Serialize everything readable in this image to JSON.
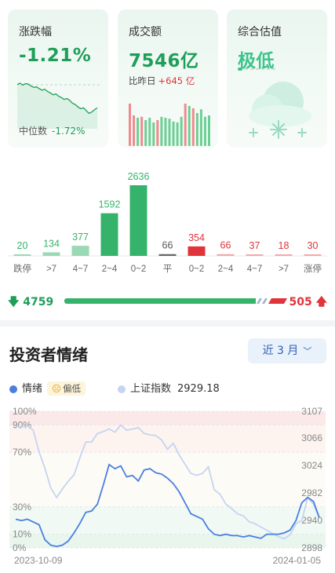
{
  "cards": {
    "change": {
      "title": "涨跌幅",
      "value": "-1.21%",
      "median_label": "中位数",
      "median_value": "-1.72%",
      "trend": [
        0.3,
        0.27,
        0.31,
        0.28,
        0.29,
        0.33,
        0.36,
        0.35,
        0.39,
        0.42,
        0.4,
        0.45,
        0.48,
        0.52,
        0.5,
        0.55,
        0.58,
        0.62,
        0.6,
        0.64,
        0.7,
        0.73,
        0.78,
        0.82,
        0.8,
        0.86,
        0.92,
        0.89,
        0.84,
        0.8
      ]
    },
    "turnover": {
      "title": "成交额",
      "value": "7546亿",
      "compare_label": "比昨日",
      "compare_value": "+645 亿",
      "bars": [
        0.9,
        0.65,
        0.6,
        0.62,
        0.55,
        0.6,
        0.5,
        0.55,
        0.62,
        0.6,
        0.58,
        0.52,
        0.5,
        0.62,
        0.9,
        0.85,
        0.8,
        0.7,
        0.78,
        0.62,
        0.65
      ],
      "bar_colors": [
        "r",
        "r",
        "g",
        "r",
        "g",
        "g",
        "g",
        "r",
        "g",
        "g",
        "g",
        "g",
        "g",
        "g",
        "r",
        "g",
        "r",
        "g",
        "g",
        "g",
        "g"
      ]
    },
    "valuation": {
      "title": "综合估值",
      "value": "极低"
    }
  },
  "histogram": {
    "categories": [
      "跌停",
      ">7",
      "4~7",
      "2~4",
      "0~2",
      "平",
      "0~2",
      "2~4",
      "4~7",
      ">7",
      "涨停"
    ],
    "values": [
      20,
      134,
      377,
      1592,
      2636,
      66,
      354,
      66,
      37,
      18,
      30
    ],
    "kinds": [
      "down",
      "down",
      "down",
      "down",
      "down",
      "flat",
      "up",
      "up",
      "up",
      "up",
      "up"
    ],
    "down_total": "4759",
    "up_total": "505"
  },
  "sentiment": {
    "title": "投资者情绪",
    "range_label": "近 3 月",
    "legend": {
      "sentiment_label": "情绪",
      "sentiment_badge": "偏低",
      "index_label": "上证指数",
      "index_value": "2929.18"
    },
    "colors": {
      "sentiment": "#4a7fe0",
      "index": "#c5d4f3"
    }
  },
  "chart_data": {
    "type": "line",
    "x_start": "2023-10-09",
    "x_end": "2024-01-05",
    "left_ticks": [
      "100%",
      "90%",
      "70%",
      "30%",
      "10%",
      "0%"
    ],
    "left_tick_values": [
      100,
      90,
      70,
      30,
      10,
      0
    ],
    "right_ticks": [
      "3107",
      "3066",
      "3024",
      "2982",
      "2940",
      "2898"
    ],
    "right_tick_values": [
      3107,
      3066,
      3024,
      2982,
      2940,
      2898
    ],
    "series": [
      {
        "name": "情绪",
        "values": [
          21,
          20,
          21,
          19,
          17,
          6,
          2,
          1,
          2,
          5,
          11,
          18,
          26,
          27,
          32,
          46,
          61,
          58,
          60,
          52,
          53,
          49,
          57,
          58,
          55,
          54,
          51,
          47,
          41,
          33,
          25,
          23,
          21,
          14,
          10,
          9,
          10,
          9,
          9,
          8,
          9,
          8,
          7,
          10,
          10,
          10,
          11,
          13,
          20,
          33,
          37,
          34,
          22
        ]
      },
      {
        "name": "上证指数",
        "values": [
          3084,
          3083,
          3085,
          3078,
          3045,
          3020,
          2990,
          2975,
          2988,
          3000,
          3010,
          3036,
          3060,
          3060,
          3073,
          3076,
          3080,
          3075,
          3086,
          3078,
          3080,
          3082,
          3073,
          3071,
          3070,
          3063,
          3049,
          3058,
          3040,
          3026,
          3012,
          3009,
          3012,
          3022,
          2987,
          2980,
          2965,
          2958,
          2950,
          2947,
          2938,
          2935,
          2930,
          2925,
          2920,
          2915,
          2912,
          2918,
          2935,
          2940,
          2975,
          2965,
          2944
        ]
      }
    ]
  }
}
